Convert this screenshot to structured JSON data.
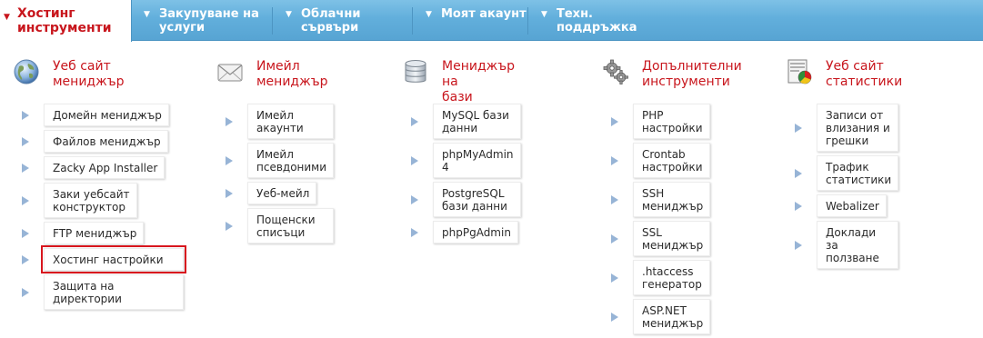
{
  "nav": {
    "active": {
      "line1": "Хостинг",
      "line2": "инструменти"
    },
    "items": [
      {
        "line1": "Закупуване на",
        "line2": "услуги"
      },
      {
        "line1": "Облачни",
        "line2": "сървъри"
      },
      {
        "line1": "Моят акаунт",
        "line2": ""
      },
      {
        "line1": "Техн.",
        "line2": "поддръжка"
      }
    ],
    "arrow": "▼"
  },
  "columns": [
    {
      "title": "Уеб сайт\nмениджър",
      "icon": "globe-icon",
      "items": [
        "Домейн мениджър",
        "Файлов мениджър",
        "Zacky App Installer",
        "Заки уебсайт\nконструктор",
        "FTP мениджър",
        "Хостинг настройки",
        "Защита на директории"
      ]
    },
    {
      "title": "Имейл\nмениджър",
      "icon": "envelope-icon",
      "items": [
        "Имейл акаунти",
        "Имейл псевдоними",
        "Уеб-мейл",
        "Пощенски списъци"
      ]
    },
    {
      "title": "Мениджър на\nбази данни",
      "icon": "database-icon",
      "items": [
        "MySQL бази данни",
        "phpMyAdmin 4",
        "PostgreSQL бази данни",
        "phpPgAdmin"
      ]
    },
    {
      "title": "Допълнителни\nинструменти",
      "icon": "gears-icon",
      "items": [
        "PHP настройки",
        "Crontab настройки",
        "SSH мениджър",
        "SSL мениджър",
        ".htaccess генератор",
        "ASP.NET мениджър"
      ]
    },
    {
      "title": "Уеб сайт\nстатистики",
      "icon": "chart-icon",
      "items": [
        "Записи от влизания и\nгрешки",
        "Трафик статистики",
        "Webalizer",
        "Доклади за ползване"
      ]
    }
  ],
  "colors": {
    "accent": "#c8161d",
    "nav_bg": "#62afdc",
    "bullet": "#97b4d6"
  }
}
